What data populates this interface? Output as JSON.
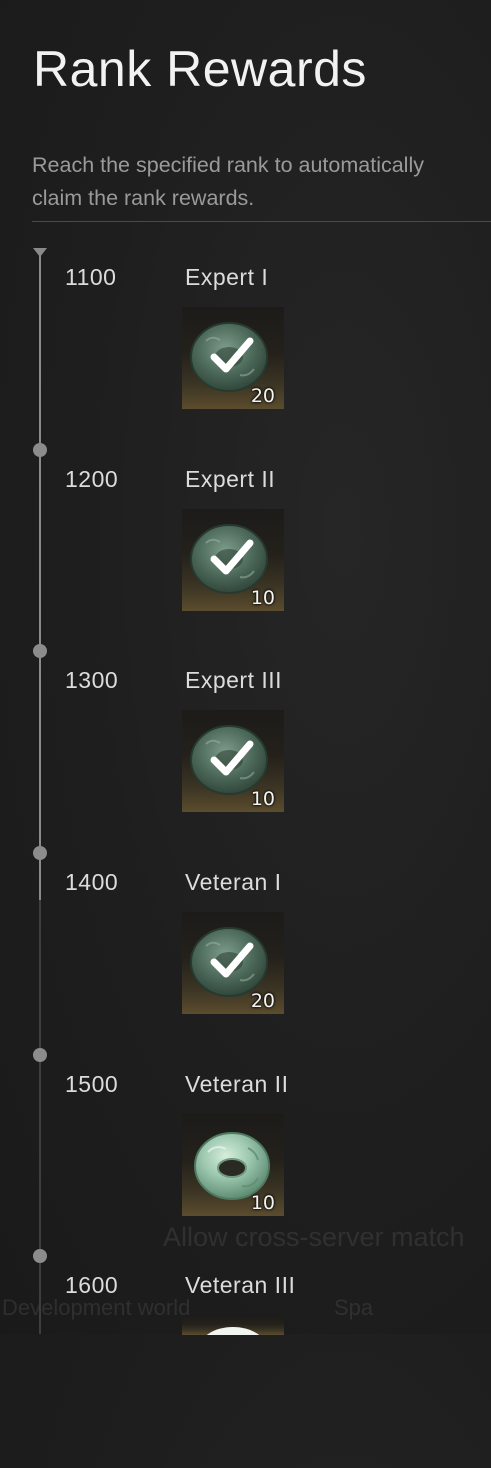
{
  "title": "Rank Rewards",
  "description": {
    "line1": "Reach the specified rank to automatically",
    "line2": "claim the rank rewards."
  },
  "tiers": [
    {
      "score": "1100",
      "name": "Expert I",
      "quantity": "20",
      "claimed": true
    },
    {
      "score": "1200",
      "name": "Expert II",
      "quantity": "10",
      "claimed": true
    },
    {
      "score": "1300",
      "name": "Expert III",
      "quantity": "10",
      "claimed": true
    },
    {
      "score": "1400",
      "name": "Veteran I",
      "quantity": "20",
      "claimed": true
    },
    {
      "score": "1500",
      "name": "Veteran II",
      "quantity": "10",
      "claimed": false
    },
    {
      "score": "1600",
      "name": "Veteran III",
      "quantity": "",
      "claimed": false
    }
  ],
  "reward_icon": "jade-ring-icon",
  "background_overlay": {
    "text1": "Allow cross-server match",
    "text2": "Development world",
    "text3": "Spa"
  },
  "colors": {
    "background": "#1f1f1f",
    "title": "#f2f2f2",
    "description": "#9a9a9a",
    "timeline_active": "#8a8a8a",
    "jade": "#7fae95"
  }
}
